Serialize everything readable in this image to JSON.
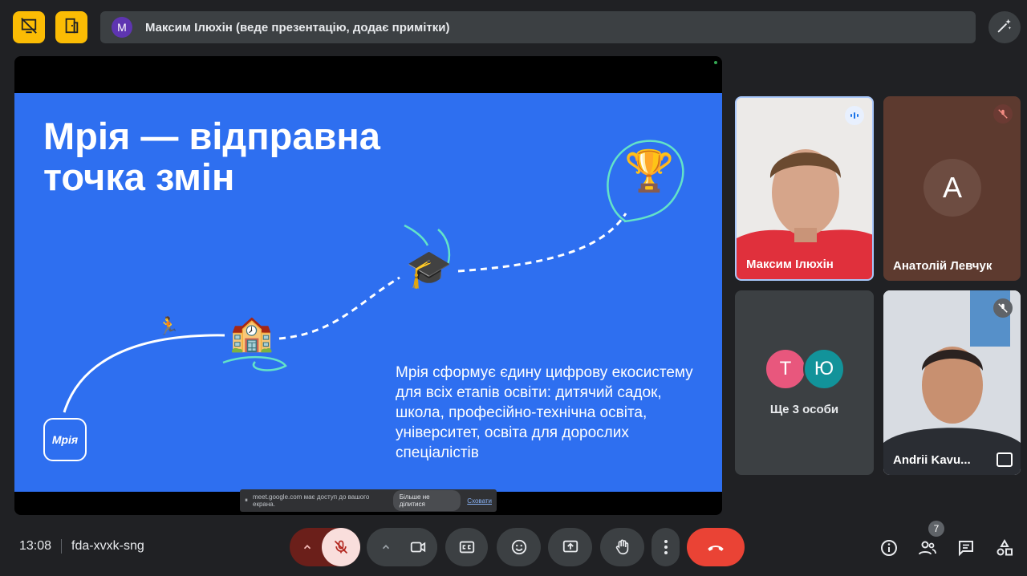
{
  "presenter": {
    "initial": "M",
    "text": "Максим Ілюхін (веде презентацію, додає примітки)"
  },
  "slide": {
    "title": "Мрія — відправна\nточка змін",
    "body": "Мрія сформує єдину цифрову екосистему для всіх етапів освіти: дитячий садок, школа, професійно-технічна освіта, університет, освіта для дорослих спеціалістів",
    "logo_text": "Мрія",
    "emoji_runner": "🏃",
    "emoji_school": "🏫",
    "emoji_cap": "🎓",
    "emoji_trophy": "🏆"
  },
  "share_bar": {
    "text": "meet.google.com має доступ до вашого екрана.",
    "stop_label": "Більше не ділитися",
    "hide_label": "Сховати"
  },
  "participants": {
    "maksym": {
      "name": "Максим Ілюхін"
    },
    "anatolii": {
      "name": "Анатолій Левчук",
      "initial": "А"
    },
    "others": {
      "initial_1": "Т",
      "initial_2": "Ю",
      "label": "Ще 3 особи"
    },
    "andrii": {
      "name": "Andrii Kavu..."
    }
  },
  "meeting": {
    "time": "13:08",
    "code": "fda-xvxk-sng"
  },
  "people_count": "7",
  "colors": {
    "accent_yellow": "#fbbc04",
    "slide_blue": "#2e6ff0",
    "end_call": "#ea4335",
    "mic_off_bg": "#f9dedc"
  }
}
